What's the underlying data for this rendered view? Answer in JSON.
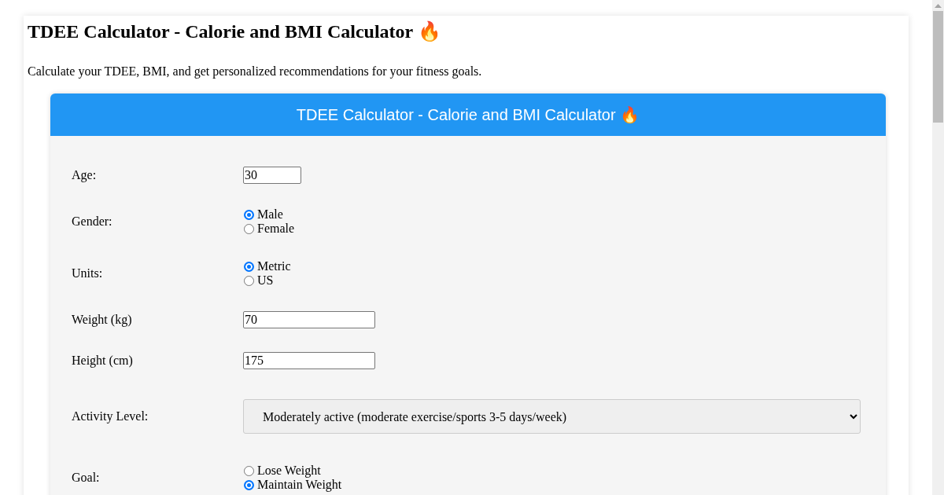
{
  "page": {
    "title": "TDEE Calculator - Calorie and BMI Calculator 🔥",
    "intro": "Calculate your TDEE, BMI, and get personalized recommendations for your fitness goals."
  },
  "calculator": {
    "title": "TDEE Calculator - Calorie and BMI Calculator 🔥",
    "fields": [
      {
        "kind": "short_input",
        "label": "Age:",
        "value": "30"
      },
      {
        "kind": "radio",
        "label": "Gender:",
        "options": [
          {
            "label": "Male",
            "selected": true
          },
          {
            "label": "Female",
            "selected": false
          }
        ]
      },
      {
        "kind": "radio",
        "label": "Units:",
        "options": [
          {
            "label": "Metric",
            "selected": true
          },
          {
            "label": "US",
            "selected": false
          }
        ]
      },
      {
        "kind": "input",
        "label": "Weight (kg)",
        "value": "70"
      },
      {
        "kind": "input",
        "label": "Height (cm)",
        "value": "175"
      },
      {
        "kind": "select",
        "label": "Activity Level:",
        "value": "Moderately active (moderate exercise/sports 3-5 days/week)"
      },
      {
        "kind": "radio",
        "label": "Goal:",
        "options": [
          {
            "label": "Lose Weight",
            "selected": false
          },
          {
            "label": "Maintain Weight",
            "selected": true
          }
        ]
      }
    ]
  }
}
